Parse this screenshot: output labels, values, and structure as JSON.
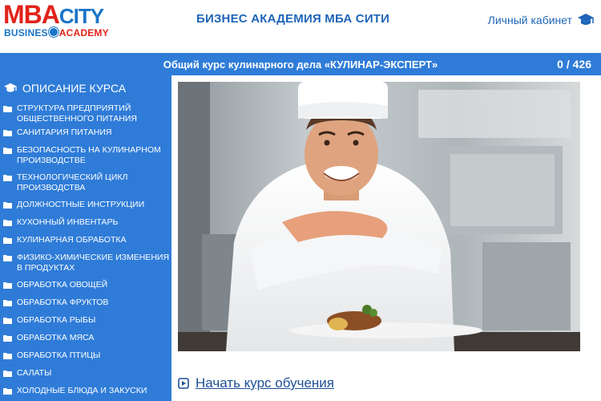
{
  "header": {
    "logo": {
      "top_left": "MBA",
      "top_right": "CITY",
      "bottom_left": "BUSINES",
      "bottom_right": "ACADEMY"
    },
    "site_title": "БИЗНЕС АКАДЕМИЯ МБА СИТИ",
    "cabinet_label": "Личный кабинет",
    "cabinet_icon": "graduation-cap-icon"
  },
  "topbar": {
    "course_title": "Общий курс кулинарного дела «КУЛИНАР-ЭКСПЕРТ»",
    "counter": "0 / 426"
  },
  "sidebar": {
    "heading": "ОПИСАНИЕ КУРСА",
    "heading_icon": "graduation-cap-icon",
    "item_icon": "folder-icon",
    "items": [
      {
        "label": "СТРУКТУРА ПРЕДПРИЯТИЙ ОБЩЕСТВЕННОГО ПИТАНИЯ"
      },
      {
        "label": "САНИТАРИЯ ПИТАНИЯ"
      },
      {
        "label": "БЕЗОПАСНОСТЬ НА КУЛИНАРНОМ ПРОИЗВОДСТВЕ"
      },
      {
        "label": "ТЕХНОЛОГИЧЕСКИЙ ЦИКЛ ПРОИЗВОДСТВА"
      },
      {
        "label": "ДОЛЖНОСТНЫЕ ИНСТРУКЦИИ"
      },
      {
        "label": "КУХОННЫЙ ИНВЕНТАРЬ"
      },
      {
        "label": "КУЛИНАРНАЯ ОБРАБОТКА"
      },
      {
        "label": "ФИЗИКО-ХИМИЧЕСКИЕ ИЗМЕНЕНИЯ В ПРОДУКТАХ"
      },
      {
        "label": "ОБРАБОТКА ОВОЩЕЙ"
      },
      {
        "label": "ОБРАБОТКА ФРУКТОВ"
      },
      {
        "label": "ОБРАБОТКА РЫБЫ"
      },
      {
        "label": "ОБРАБОТКА МЯСА"
      },
      {
        "label": "ОБРАБОТКА ПТИЦЫ"
      },
      {
        "label": "САЛАТЫ"
      },
      {
        "label": "ХОЛОДНЫЕ БЛЮДА И ЗАКУСКИ"
      }
    ]
  },
  "main": {
    "photo_subject": "chef-photo",
    "start_label": "Начать курс обучения",
    "start_icon": "play-square-icon"
  },
  "colors": {
    "accent_blue": "#2f7cd8",
    "title_blue": "#1f65b8",
    "brand_red": "#e2231a"
  }
}
